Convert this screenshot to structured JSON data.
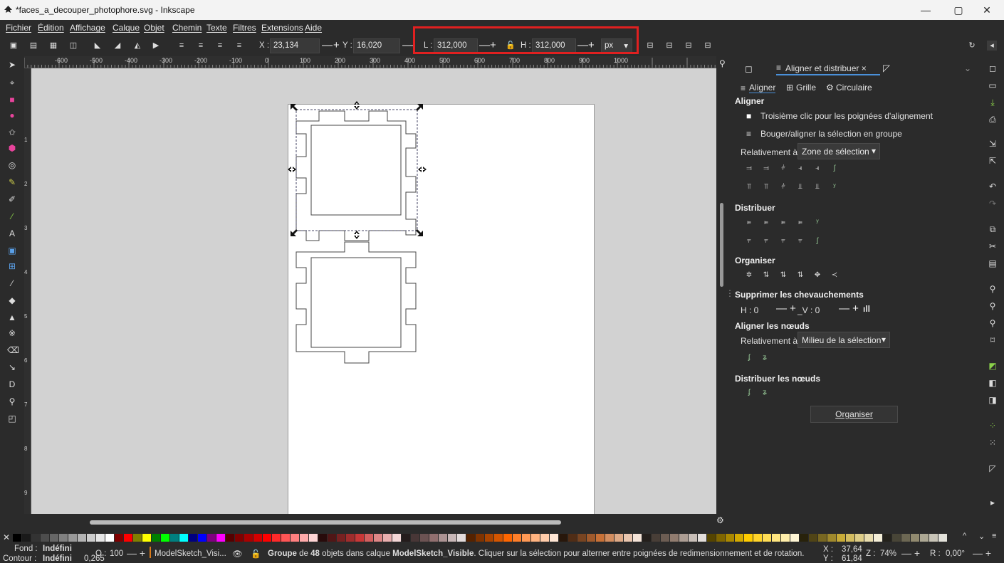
{
  "window": {
    "title": "*faces_a_decouper_photophore.svg - Inkscape",
    "controls": [
      "—",
      "▢",
      "✕"
    ]
  },
  "menubar": {
    "items": [
      "Fichier",
      "Édition",
      "Affichage",
      "Calque",
      "Objet",
      "Chemin",
      "Texte",
      "Filtres",
      "Extensions",
      "Aide"
    ]
  },
  "toolbar": {
    "x_label": "X :",
    "x_value": "23,134",
    "y_label": "Y :",
    "y_value": "16,020",
    "w_label": "L :",
    "w_value": "312,000",
    "h_label": "H :",
    "h_value": "312,000",
    "unit": "px",
    "plus": "+",
    "minus": "—"
  },
  "ruler": {
    "top_ticks": [
      "-600",
      "-500",
      "-400",
      "-300",
      "-200",
      "-100",
      "0",
      "100",
      "200",
      "300",
      "400",
      "500",
      "600",
      "700",
      "800",
      "900",
      "1000"
    ],
    "left_ticks": [
      "1",
      "2",
      "3",
      "4",
      "5",
      "6",
      "7",
      "8",
      "9"
    ]
  },
  "panel": {
    "tab_label": "Aligner et distribuer ×",
    "subtabs": [
      "Aligner",
      "Grille",
      "Circulaire"
    ],
    "aligner_heading": "Aligner",
    "third_click": "Troisième clic pour les poignées d'alignement",
    "move_group": "Bouger/aligner la sélection en groupe",
    "relative_label": "Relativement à :",
    "relative_value": "Zone de sélection",
    "distribuer_heading": "Distribuer",
    "organiser_heading": "Organiser",
    "overlap_heading": "Supprimer les chevauchements",
    "h_label": "H : 0",
    "v_label": "_V : 0",
    "align_nodes_heading": "Aligner les nœuds",
    "nodes_relative_label": "Relativement à :",
    "nodes_relative_value": "Milieu de la sélection",
    "distribute_nodes_heading": "Distribuer les nœuds",
    "organise_button": "Organiser"
  },
  "status": {
    "fond_label": "Fond :",
    "fond_value": "Indéfini",
    "contour_label": "Contour :",
    "contour_value": "Indéfini",
    "stroke_width": "0,265",
    "opacity_label": "O :",
    "opacity_value": "100",
    "layer": "ModelSketch_Visi...",
    "message_prefix": "Groupe",
    "message_mid1": " de ",
    "message_count": "48",
    "message_mid2": " objets dans calque ",
    "message_layer": "ModelSketch_Visible",
    "message_suffix": ". Cliquer sur la sélection pour alterner entre poignées de redimensionnement et de rotation.",
    "x_label": "X :",
    "x_value": "37,64",
    "y_label": "Y :",
    "y_value": "61,84",
    "zoom_label": "Z :",
    "zoom_value": "74%",
    "rot_label": "R :",
    "rot_value": "0,00°"
  },
  "palette": {
    "colors": [
      "#000000",
      "#1a1a1a",
      "#333333",
      "#4d4d4d",
      "#666666",
      "#808080",
      "#999999",
      "#b3b3b3",
      "#cccccc",
      "#e6e6e6",
      "#ffffff",
      "#800000",
      "#ff0000",
      "#808000",
      "#ffff00",
      "#008000",
      "#00ff00",
      "#008080",
      "#00ffff",
      "#000080",
      "#0000ff",
      "#800080",
      "#ff00ff",
      "#550000",
      "#800000",
      "#aa0000",
      "#d40000",
      "#ff0000",
      "#ff2a2a",
      "#ff5555",
      "#ff8080",
      "#ffaaaa",
      "#ffd5d5",
      "#280b0b",
      "#501616",
      "#782121",
      "#a02c2c",
      "#c83737",
      "#d35f5f",
      "#de8787",
      "#e9afaf",
      "#f4d7d7",
      "#241c1c",
      "#483737",
      "#6c5353",
      "#916f6f",
      "#ac9393",
      "#c8b7b7",
      "#e3dbdb",
      "#552200",
      "#803300",
      "#aa4400",
      "#d45500",
      "#ff6600",
      "#ff7f2a",
      "#ff9955",
      "#ffb380",
      "#ffccaa",
      "#ffe6d5",
      "#28170b",
      "#502d16",
      "#784421",
      "#a05a2c",
      "#c87137",
      "#d38d5f",
      "#deaa87",
      "#e9c6af",
      "#f4e3d7",
      "#241f1c",
      "#483e37",
      "#6c5d53",
      "#917c6f",
      "#ac9d93",
      "#c8beb7",
      "#e3dedb",
      "#554400",
      "#806600",
      "#aa8800",
      "#d4aa00",
      "#ffcc00",
      "#ffd42a",
      "#ffdd55",
      "#ffe680",
      "#ffeeaa",
      "#fff6d5",
      "#28220b",
      "#504416",
      "#786721",
      "#a0892c",
      "#c8ab37",
      "#d3bc5f",
      "#decd87",
      "#e9ddaf",
      "#f4eed7",
      "#24221c",
      "#484537",
      "#6c6753",
      "#918a6f",
      "#aca793",
      "#c8c4b7",
      "#e3e2db"
    ]
  }
}
